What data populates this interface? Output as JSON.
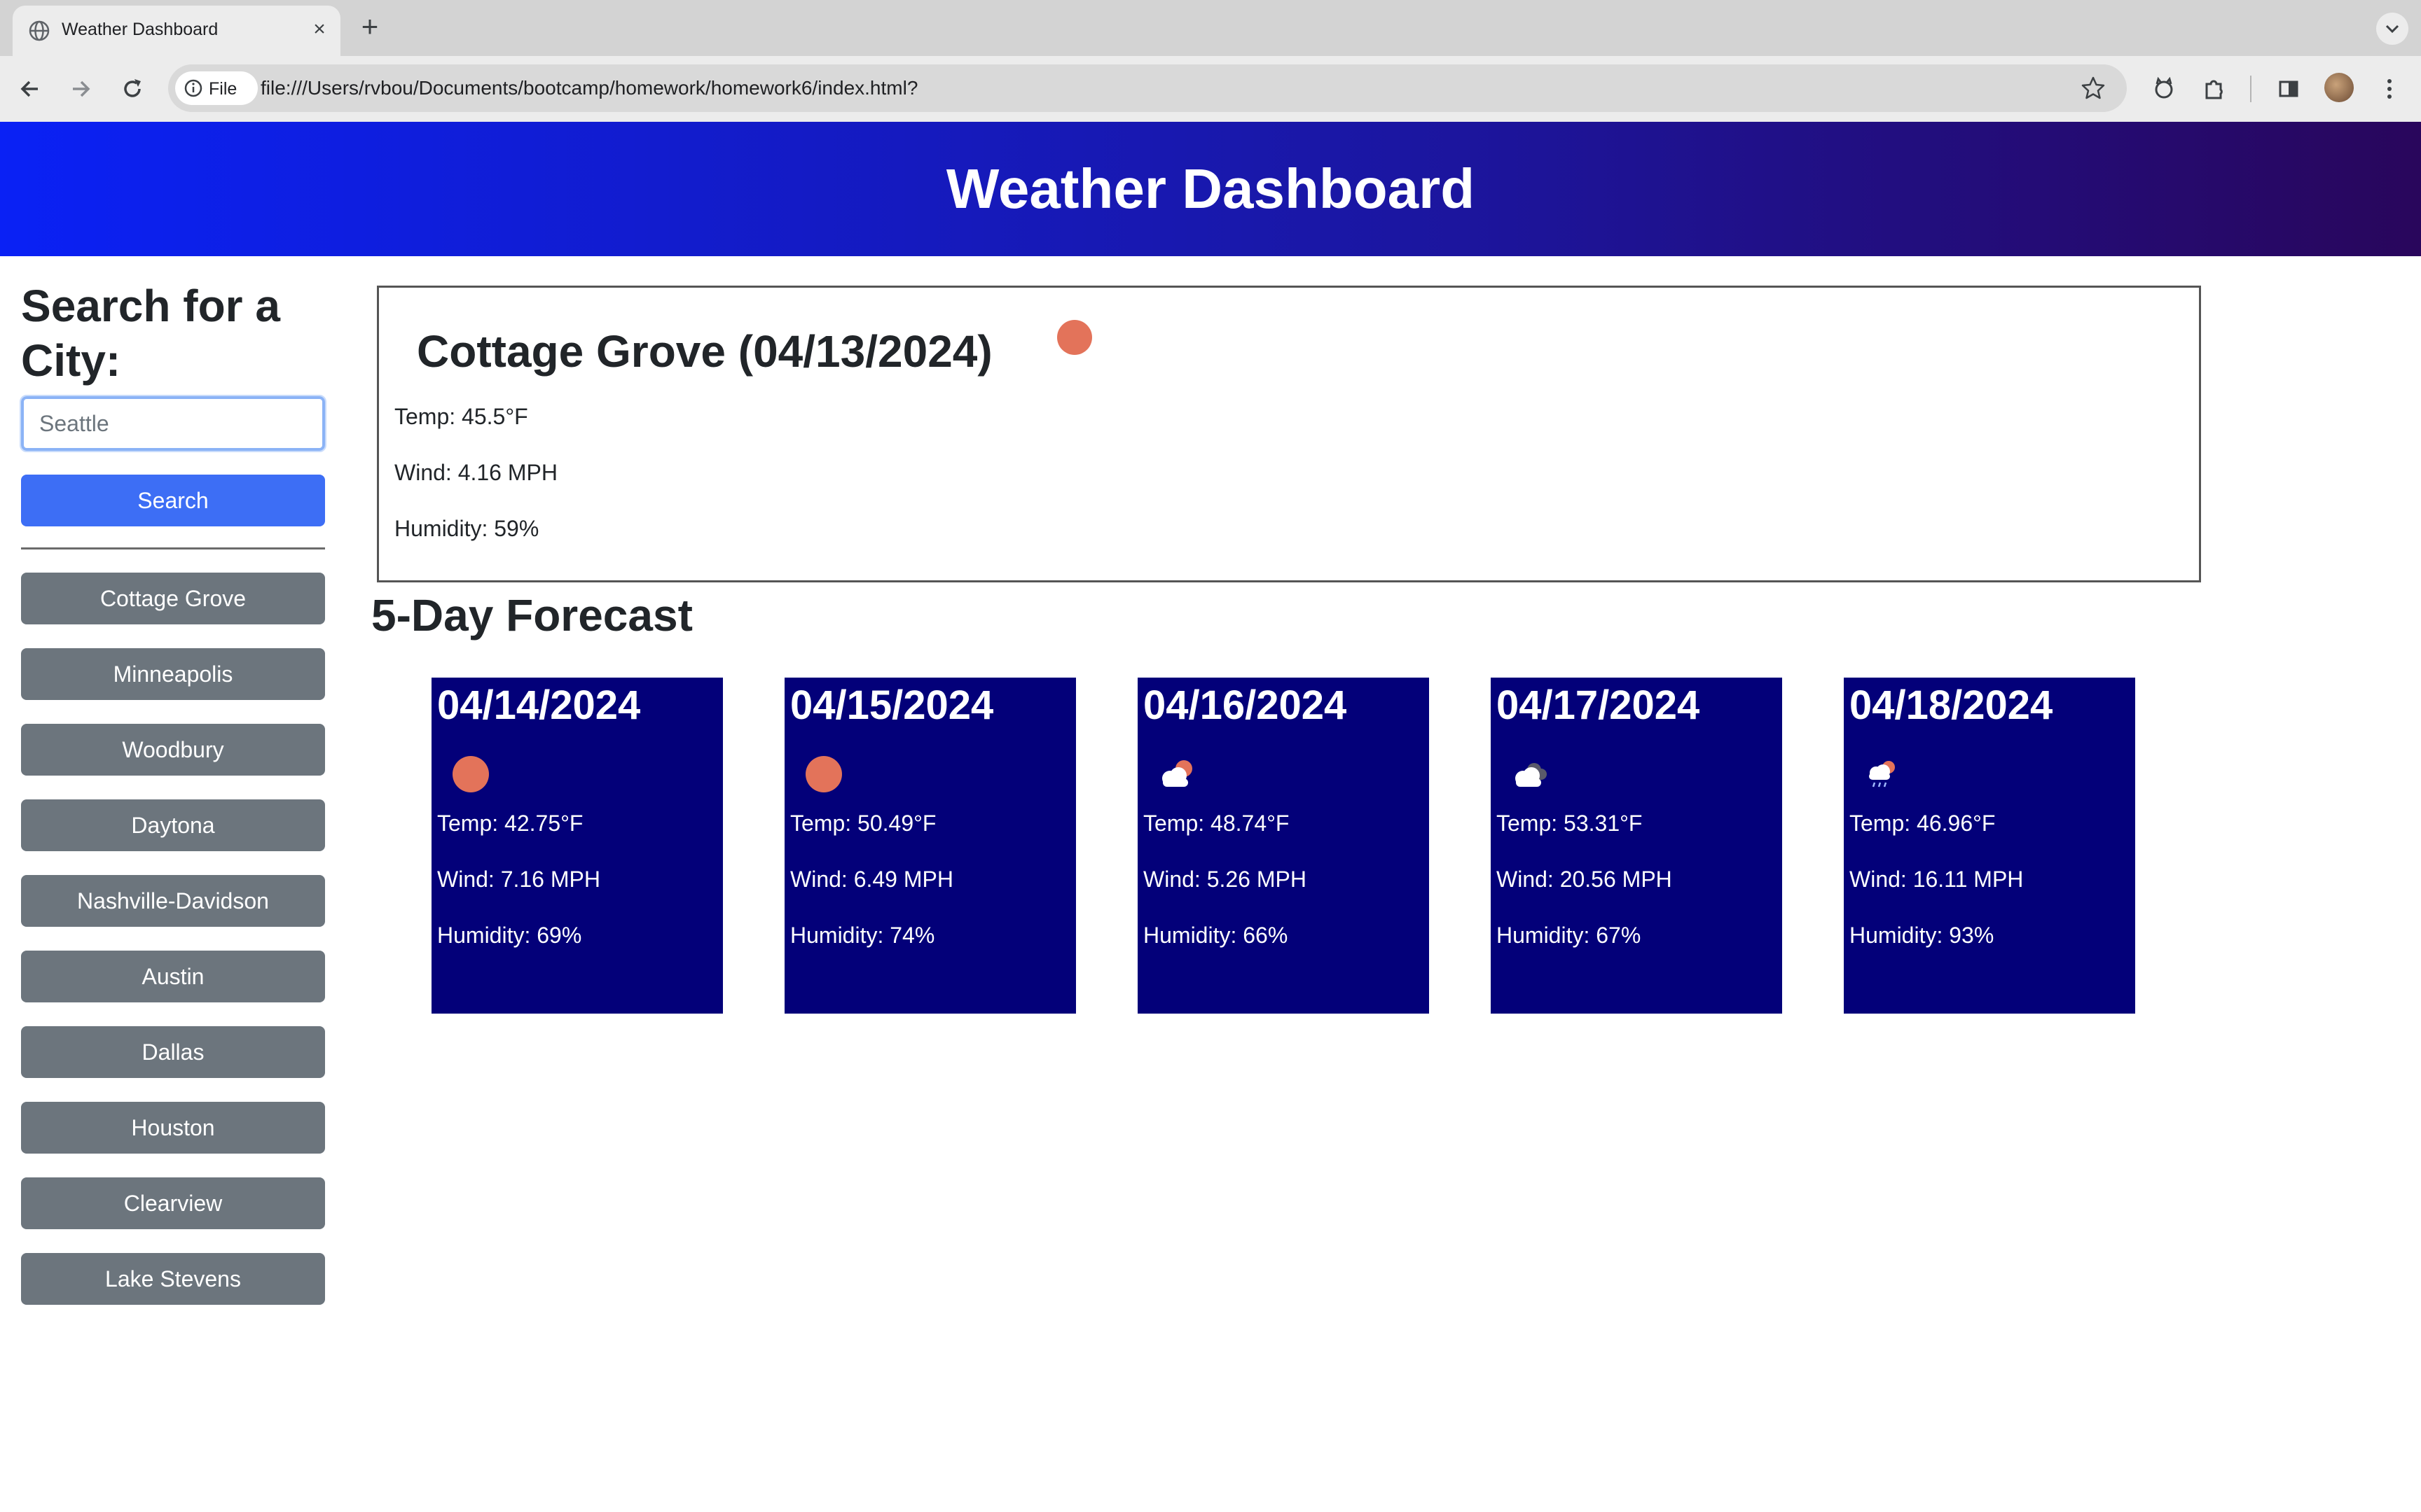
{
  "browser": {
    "tab_title": "Weather Dashboard",
    "new_tab_symbol": "+",
    "close_symbol": "×",
    "file_label": "File",
    "url": "file:///Users/rvbou/Documents/bootcamp/homework/homework6/index.html?"
  },
  "header": {
    "title": "Weather Dashboard"
  },
  "sidebar": {
    "title": "Search for a City:",
    "search_placeholder": "Seattle",
    "search_button": "Search",
    "history": [
      "Cottage Grove",
      "Minneapolis",
      "Woodbury",
      "Daytona",
      "Nashville-Davidson",
      "Austin",
      "Dallas",
      "Houston",
      "Clearview",
      "Lake Stevens"
    ]
  },
  "current": {
    "title": "Cottage Grove (04/13/2024)",
    "icon": "sun-icon",
    "temp": "Temp: 45.5°F",
    "wind": "Wind: 4.16 MPH",
    "humidity": "Humidity: 59%"
  },
  "forecast": {
    "title": "5-Day Forecast",
    "days": [
      {
        "date": "04/14/2024",
        "icon": "sun-icon",
        "temp": "Temp: 42.75°F",
        "wind": "Wind: 7.16 MPH",
        "humidity": "Humidity: 69%"
      },
      {
        "date": "04/15/2024",
        "icon": "sun-icon",
        "temp": "Temp: 50.49°F",
        "wind": "Wind: 6.49 MPH",
        "humidity": "Humidity: 74%"
      },
      {
        "date": "04/16/2024",
        "icon": "partly-cloudy-icon",
        "temp": "Temp: 48.74°F",
        "wind": "Wind: 5.26 MPH",
        "humidity": "Humidity: 66%"
      },
      {
        "date": "04/17/2024",
        "icon": "cloudy-icon",
        "temp": "Temp: 53.31°F",
        "wind": "Wind: 20.56 MPH",
        "humidity": "Humidity: 67%"
      },
      {
        "date": "04/18/2024",
        "icon": "rain-sun-icon",
        "temp": "Temp: 46.96°F",
        "wind": "Wind: 16.11 MPH",
        "humidity": "Humidity: 93%"
      }
    ]
  },
  "colors": {
    "header_gradient_start": "#0a21f5",
    "header_gradient_end": "#29065c",
    "forecast_card": "#030079",
    "search_button": "#3d6ef5",
    "history_button": "#6c757d",
    "sun": "#e3735a"
  }
}
